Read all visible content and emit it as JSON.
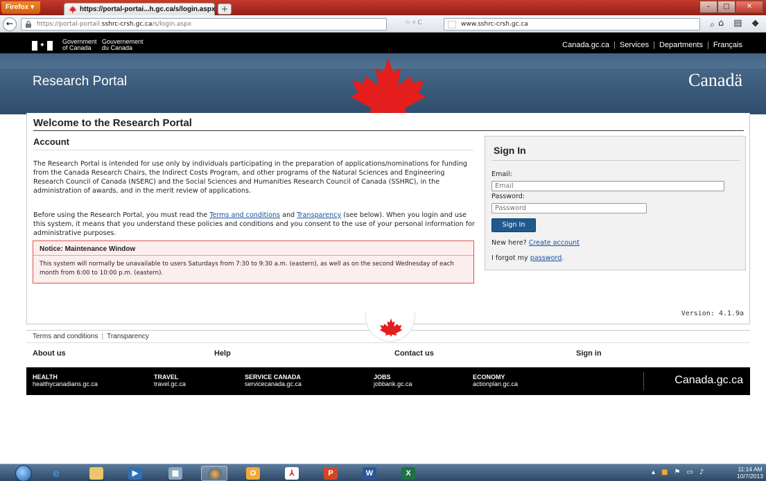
{
  "browser": {
    "menu_label": "Firefox ▾",
    "tab_title": "https://portal-portai...h.gc.ca/s/login.aspx",
    "new_tab": "+",
    "url_prefix": "https://portal-portail.",
    "url_host": "sshrc-crsh.gc.ca",
    "url_path": "/s/login.aspx",
    "search_text": "www.sshrc-crsh.gc.ca"
  },
  "gov": {
    "en_line1": "Government",
    "en_line2": "of Canada",
    "fr_line1": "Gouvernement",
    "fr_line2": "du Canada",
    "nav": [
      "Canada.gc.ca",
      "Services",
      "Departments",
      "Français"
    ]
  },
  "banner": {
    "title": "Research Portal",
    "wordmark": "Canadä"
  },
  "main": {
    "page_title": "Welcome to the Research Portal",
    "account_heading": "Account",
    "intro": "The Research Portal is intended for use only by individuals participating in the preparation of applications/nominations for funding from the Canada Research Chairs, the Indirect Costs Program, and other programs of the Natural Sciences and Engineering Research Council of Canada (NSERC) and the Social Sciences and Humanities Research Council of Canada (SSHRC), in the administration of awards, and in the merit review of applications.",
    "before_text": "Before using the Research Portal, you must read the",
    "terms_link": "Terms and conditions",
    "and_text": "and",
    "transparency_link": "Transparency",
    "after_text": "(see below). When you login and use this system, it means that you understand these policies and conditions and you consent to the use of your personal information for administrative purposes.",
    "notice_heading": "Notice: Maintenance Window",
    "notice_body": "This system will normally be unavailable to users Saturdays from 7:30 to 9:30 a.m. (eastern), as well as on the second Wednesday of each month from 6:00 to 10:00 p.m. (eastern).",
    "version": "Version:  4.1.9a"
  },
  "signin": {
    "heading": "Sign In",
    "email_label": "Email:",
    "email_placeholder": "Email",
    "password_label": "Password:",
    "password_placeholder": "Password",
    "button": "Sign In",
    "new_here": "New here?",
    "create_account": "Create account",
    "forgot_prefix": "I forgot my",
    "forgot_link": "password",
    "forgot_suffix": "."
  },
  "footer": {
    "links": [
      "Terms and conditions",
      "Transparency"
    ],
    "nav": [
      "About us",
      "Help",
      "Contact us",
      "Sign in"
    ],
    "themes": [
      {
        "title": "HEALTH",
        "site": "healthycanadians.gc.ca"
      },
      {
        "title": "TRAVEL",
        "site": "travel.gc.ca"
      },
      {
        "title": "SERVICE CANADA",
        "site": "servicecanada.gc.ca"
      },
      {
        "title": "JOBS",
        "site": "jobbank.gc.ca"
      },
      {
        "title": "ECONOMY",
        "site": "actionplan.gc.ca"
      }
    ],
    "canada_site": "Canada.gc.ca"
  },
  "taskbar": {
    "time": "11:14 AM",
    "date": "10/7/2013",
    "apps": [
      "internet-explorer",
      "file-explorer",
      "media-player",
      "calculator",
      "firefox",
      "outlook",
      "acrobat",
      "powerpoint",
      "word",
      "excel"
    ]
  },
  "colors": {
    "banner_blue": "#3b5b7b",
    "leaf_red": "#e41d1d",
    "link_blue": "#1a4e9b",
    "button_blue": "#1e5a8c"
  }
}
